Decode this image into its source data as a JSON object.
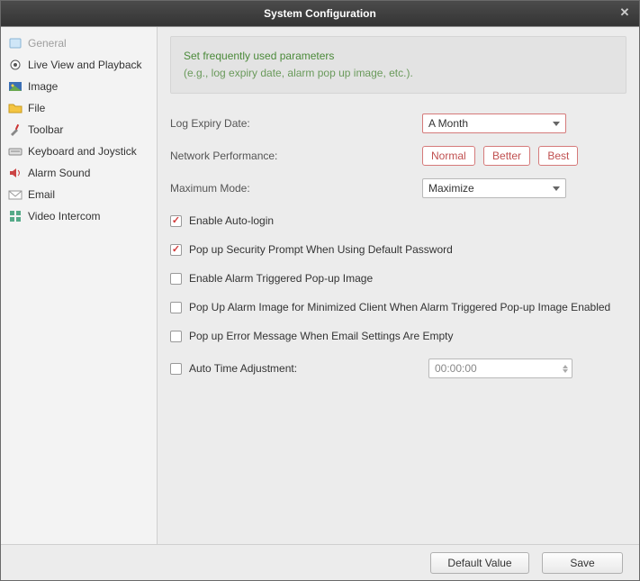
{
  "title": "System Configuration",
  "sidebar": {
    "items": [
      {
        "label": "General"
      },
      {
        "label": "Live View and Playback"
      },
      {
        "label": "Image"
      },
      {
        "label": "File"
      },
      {
        "label": "Toolbar"
      },
      {
        "label": "Keyboard and Joystick"
      },
      {
        "label": "Alarm Sound"
      },
      {
        "label": "Email"
      },
      {
        "label": "Video Intercom"
      }
    ]
  },
  "hint": {
    "line1": "Set frequently used parameters",
    "line2": "(e.g., log expiry date, alarm pop up image, etc.)."
  },
  "labels": {
    "log_expiry": "Log Expiry Date:",
    "network_perf": "Network Performance:",
    "max_mode": "Maximum Mode:",
    "auto_login": "Enable Auto-login",
    "sec_prompt": "Pop up Security Prompt When Using Default Password",
    "alarm_popup": "Enable Alarm Triggered Pop-up Image",
    "min_client": "Pop Up Alarm Image for Minimized Client When Alarm Triggered Pop-up Image Enabled",
    "email_err": "Pop up Error Message When Email Settings Are Empty",
    "auto_time": "Auto Time Adjustment:"
  },
  "values": {
    "log_expiry": "A Month",
    "perf_normal": "Normal",
    "perf_better": "Better",
    "perf_best": "Best",
    "max_mode": "Maximize",
    "auto_time": "00:00:00"
  },
  "footer": {
    "default": "Default Value",
    "save": "Save"
  }
}
